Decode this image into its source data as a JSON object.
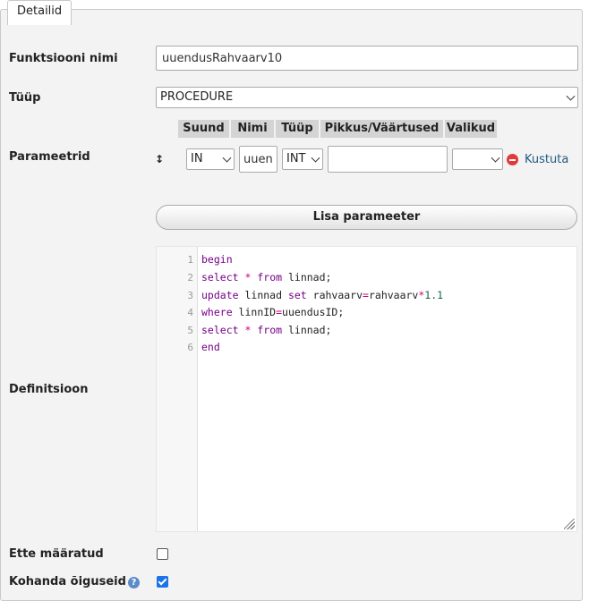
{
  "fieldset": {
    "legend": "Detailid"
  },
  "name_row": {
    "label": "Funktsiooni nimi",
    "value": "uuendusRahvaarv10"
  },
  "type_row": {
    "label": "Tüüp",
    "selected": "PROCEDURE"
  },
  "params": {
    "label": "Parameetrid",
    "headers": [
      "Suund",
      "Nimi",
      "Tüüp",
      "Pikkus/Väärtused",
      "Valikud"
    ],
    "rows": [
      {
        "direction": "IN",
        "name": "uuen",
        "type": "INT",
        "length": "",
        "options": "",
        "delete_label": "Kustuta"
      }
    ],
    "add_button": "Lisa parameeter"
  },
  "definition": {
    "label": "Definitsioon",
    "line_numbers": [
      "1",
      "2",
      "3",
      "4",
      "5",
      "6"
    ]
  },
  "deterministic": {
    "label": "Ette määratud",
    "checked": false
  },
  "adjust_privileges": {
    "label": "Kohanda õiguseid",
    "checked": true
  },
  "colors": {
    "keyword": "#770088",
    "operator": "#cc0077",
    "number": "#116644",
    "delete_icon": "#e03a3a",
    "link": "#235a81",
    "checkbox": "#1a73e8"
  }
}
